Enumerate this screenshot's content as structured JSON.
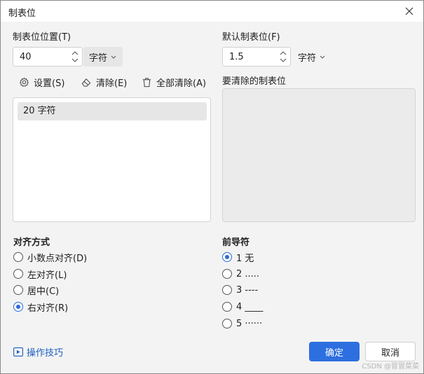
{
  "window": {
    "title": "制表位"
  },
  "tab_position": {
    "label": "制表位位置(T)",
    "value": "40",
    "unit": "字符"
  },
  "default_tab": {
    "label": "默认制表位(F)",
    "value": "1.5",
    "unit": "字符"
  },
  "toolbar": {
    "set_label": "设置(S)",
    "clear_label": "清除(E)",
    "clear_all_label": "全部清除(A)"
  },
  "tab_list": {
    "items": [
      "20 字符"
    ]
  },
  "to_clear": {
    "label": "要清除的制表位"
  },
  "alignment": {
    "title": "对齐方式",
    "options": [
      "小数点对齐(D)",
      "左对齐(L)",
      "居中(C)",
      "右对齐(R)"
    ],
    "selected": 3
  },
  "leader": {
    "title": "前导符",
    "options": [
      "1 无",
      "2 .....",
      "3 ----",
      "4 ____",
      "5  ······"
    ],
    "selected": 0
  },
  "footer": {
    "tips_label": "操作技巧",
    "ok_label": "确定",
    "cancel_label": "取消"
  },
  "watermark": "CSDN @冒冒菜菜",
  "colors": {
    "accent": "#2d6fe0",
    "link": "#1e5fbf"
  }
}
